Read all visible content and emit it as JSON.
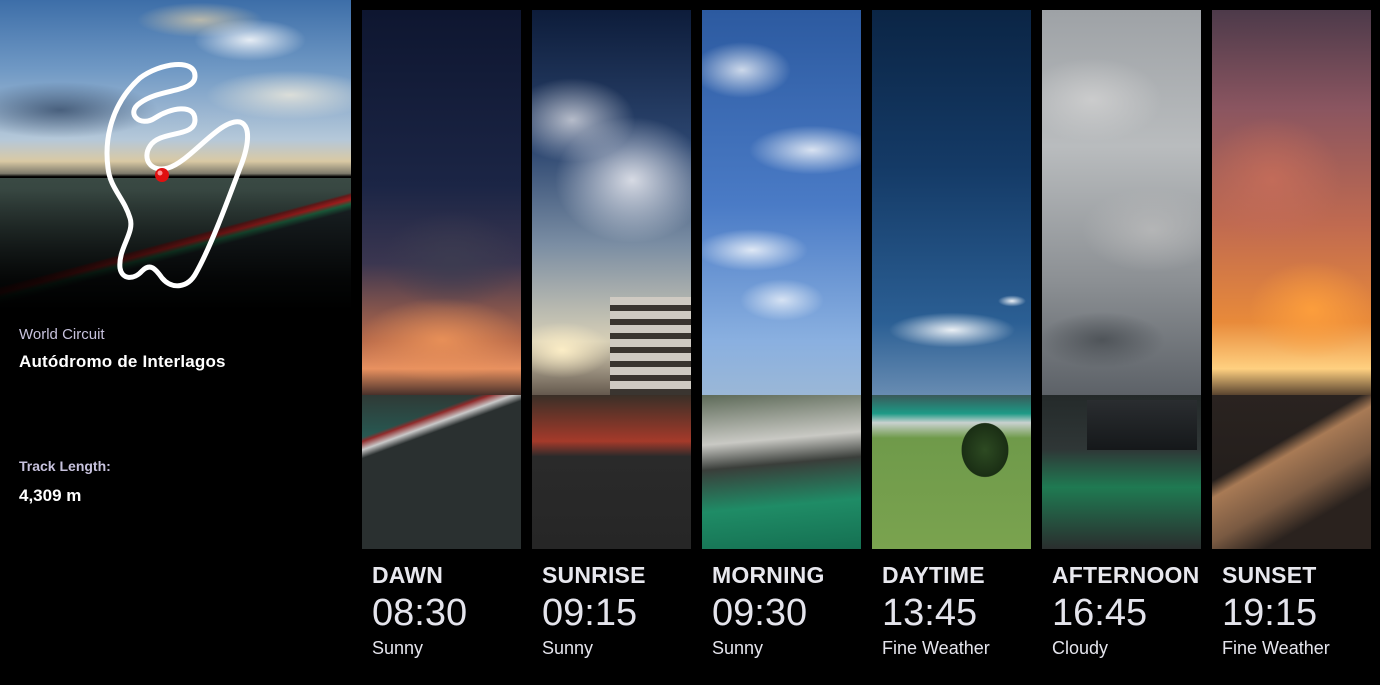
{
  "circuit": {
    "category_label": "World Circuit",
    "name": "Autódromo de Interlagos",
    "length_label": "Track Length:",
    "length_value": "4,309 m"
  },
  "time_slots": [
    {
      "label": "DAWN",
      "time": "08:30",
      "weather": "Sunny"
    },
    {
      "label": "SUNRISE",
      "time": "09:15",
      "weather": "Sunny"
    },
    {
      "label": "MORNING",
      "time": "09:30",
      "weather": "Sunny"
    },
    {
      "label": "DAYTIME",
      "time": "13:45",
      "weather": "Fine Weather"
    },
    {
      "label": "AFTERNOON",
      "time": "16:45",
      "weather": "Cloudy"
    },
    {
      "label": "SUNSET",
      "time": "19:15",
      "weather": "Fine Weather"
    }
  ],
  "colors": {
    "background": "#000000",
    "label_text": "#c7c2dd",
    "map_marker": "#e01010",
    "map_line": "#ffffff"
  }
}
